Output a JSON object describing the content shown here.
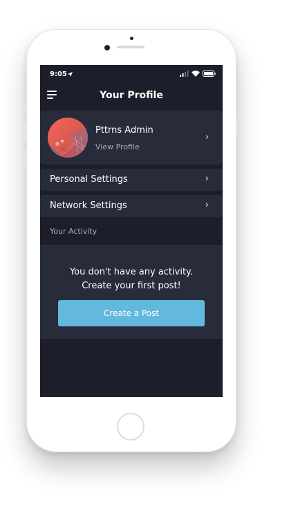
{
  "status_bar": {
    "time": "9:05"
  },
  "navbar": {
    "title": "Your Profile"
  },
  "profile": {
    "name": "Pttrns Admin",
    "link": "View Profile"
  },
  "settings": [
    {
      "label": "Personal Settings"
    },
    {
      "label": "Network Settings"
    }
  ],
  "activity": {
    "section_label": "Your Activity",
    "empty_line1": "You don't have any activity.",
    "empty_line2": "Create your first post!",
    "cta_label": "Create a Post"
  },
  "colors": {
    "screen_bg": "#1c1f2b",
    "card_bg": "#272b3a",
    "accent": "#62b9dd",
    "muted_text": "#a9adbb"
  },
  "icons": [
    "menu-icon",
    "location-arrow-icon",
    "signal-icon",
    "wifi-icon",
    "battery-icon",
    "chevron-right-icon"
  ]
}
